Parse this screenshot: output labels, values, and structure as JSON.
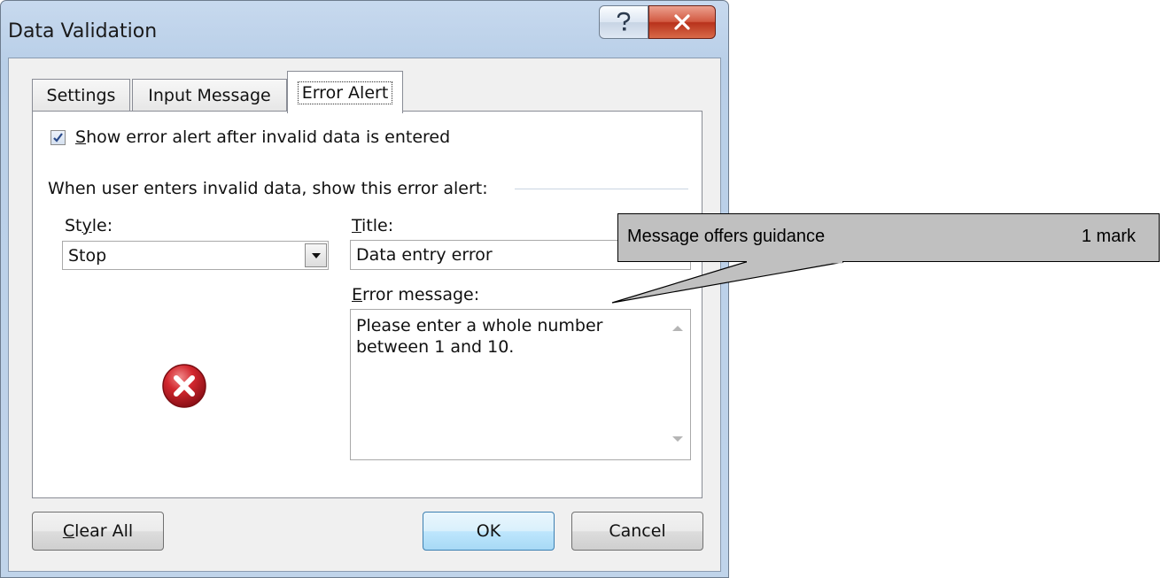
{
  "window": {
    "title": "Data Validation",
    "help_icon": "question-icon",
    "close_icon": "close-x-icon"
  },
  "tabs": [
    {
      "label": "Settings"
    },
    {
      "label": "Input Message"
    },
    {
      "label": "Error Alert",
      "selected": true
    }
  ],
  "panel": {
    "show_alert": {
      "checked": true,
      "label_mnemonic": "S",
      "label_rest": "how error alert after invalid data is entered"
    },
    "group_label": "When user enters invalid data, show this error alert:",
    "style": {
      "label_pre": "St",
      "label_mnemonic": "y",
      "label_post": "le:",
      "value": "Stop",
      "icon": "stop-error-icon"
    },
    "title": {
      "label_mnemonic": "T",
      "label_rest": "itle:",
      "value": "Data entry error"
    },
    "error_message": {
      "label_mnemonic": "E",
      "label_rest": "rror message:",
      "value": "Please enter a whole number between 1 and 10."
    }
  },
  "buttons": {
    "clear_mnemonic": "C",
    "clear_rest": "lear All",
    "ok": "OK",
    "cancel": "Cancel"
  },
  "annotation": {
    "text": "Message offers guidance",
    "mark": "1 mark"
  },
  "colors": {
    "close_button": "#c7432b",
    "ok_button_border": "#3c7fb1",
    "stop_icon": "#c0222a",
    "callout_fill": "#c0c0c0"
  }
}
